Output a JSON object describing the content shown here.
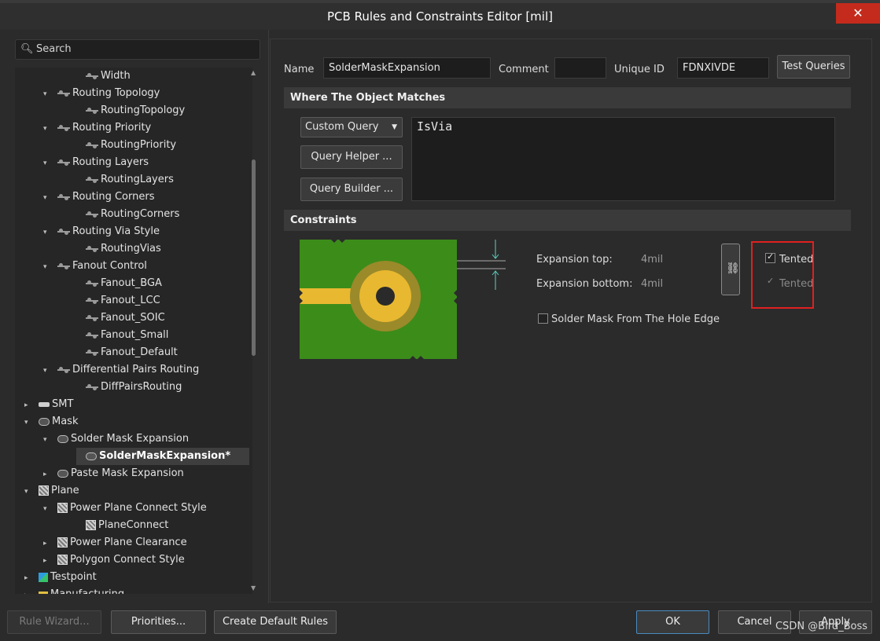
{
  "window": {
    "title": "PCB Rules and Constraints Editor [mil]",
    "close_glyph": "✕"
  },
  "search": {
    "label": "Search"
  },
  "tree": [
    {
      "label": "Width",
      "level": 3,
      "icon": "rule-icon",
      "arrow": ""
    },
    {
      "label": "Routing Topology",
      "level": 2,
      "icon": "rule-icon",
      "arrow": "▾"
    },
    {
      "label": "RoutingTopology",
      "level": 3,
      "icon": "rule-icon",
      "arrow": ""
    },
    {
      "label": "Routing Priority",
      "level": 2,
      "icon": "rule-icon",
      "arrow": "▾"
    },
    {
      "label": "RoutingPriority",
      "level": 3,
      "icon": "rule-icon",
      "arrow": ""
    },
    {
      "label": "Routing Layers",
      "level": 2,
      "icon": "rule-icon",
      "arrow": "▾"
    },
    {
      "label": "RoutingLayers",
      "level": 3,
      "icon": "rule-icon",
      "arrow": ""
    },
    {
      "label": "Routing Corners",
      "level": 2,
      "icon": "rule-icon",
      "arrow": "▾"
    },
    {
      "label": "RoutingCorners",
      "level": 3,
      "icon": "rule-icon",
      "arrow": ""
    },
    {
      "label": "Routing Via Style",
      "level": 2,
      "icon": "rule-icon",
      "arrow": "▾"
    },
    {
      "label": "RoutingVias",
      "level": 3,
      "icon": "rule-icon",
      "arrow": ""
    },
    {
      "label": "Fanout Control",
      "level": 2,
      "icon": "rule-icon",
      "arrow": "▾"
    },
    {
      "label": "Fanout_BGA",
      "level": 3,
      "icon": "rule-icon",
      "arrow": ""
    },
    {
      "label": "Fanout_LCC",
      "level": 3,
      "icon": "rule-icon",
      "arrow": ""
    },
    {
      "label": "Fanout_SOIC",
      "level": 3,
      "icon": "rule-icon",
      "arrow": ""
    },
    {
      "label": "Fanout_Small",
      "level": 3,
      "icon": "rule-icon",
      "arrow": ""
    },
    {
      "label": "Fanout_Default",
      "level": 3,
      "icon": "rule-icon",
      "arrow": ""
    },
    {
      "label": "Differential Pairs Routing",
      "level": 2,
      "icon": "rule-icon",
      "arrow": "▾"
    },
    {
      "label": "DiffPairsRouting",
      "level": 3,
      "icon": "rule-icon",
      "arrow": ""
    },
    {
      "label": "SMT",
      "level": 1,
      "icon": "smt-icon",
      "arrow": "▸"
    },
    {
      "label": "Mask",
      "level": 1,
      "icon": "mask-icon",
      "arrow": "▾"
    },
    {
      "label": "Solder Mask Expansion",
      "level": 2,
      "icon": "mask-icon",
      "arrow": "▾"
    },
    {
      "label": "SolderMaskExpansion*",
      "level": 3,
      "icon": "mask-icon",
      "arrow": "",
      "selected": true
    },
    {
      "label": "Paste Mask Expansion",
      "level": 2,
      "icon": "mask-icon",
      "arrow": "▸"
    },
    {
      "label": "Plane",
      "level": 1,
      "icon": "plane-icon",
      "arrow": "▾"
    },
    {
      "label": "Power Plane Connect Style",
      "level": 2,
      "icon": "plane-icon",
      "arrow": "▾"
    },
    {
      "label": "PlaneConnect",
      "level": 3,
      "icon": "plane-icon",
      "arrow": ""
    },
    {
      "label": "Power Plane Clearance",
      "level": 2,
      "icon": "plane-icon",
      "arrow": "▸"
    },
    {
      "label": "Polygon Connect Style",
      "level": 2,
      "icon": "plane-icon",
      "arrow": "▸"
    },
    {
      "label": "Testpoint",
      "level": 1,
      "icon": "testpoint-icon",
      "arrow": "▸"
    },
    {
      "label": "Manufacturing",
      "level": 1,
      "icon": "manufacturing-icon",
      "arrow": "▸"
    }
  ],
  "rule": {
    "name_label": "Name",
    "name_value": "SolderMaskExpansion",
    "comment_label": "Comment",
    "comment_value": "",
    "uid_label": "Unique ID",
    "uid_value": "FDNXIVDE",
    "test_queries": "Test Queries"
  },
  "where": {
    "header": "Where The Object Matches",
    "query_type": "Custom Query",
    "query_helper": "Query Helper ...",
    "query_builder": "Query Builder ...",
    "query_text": "IsVia"
  },
  "constraints": {
    "header": "Constraints",
    "expansion_top_label": "Expansion top:",
    "expansion_top_value": "4mil",
    "expansion_bottom_label": "Expansion bottom:",
    "expansion_bottom_value": "4mil",
    "tented_top_label": "Tented",
    "tented_top_checked": true,
    "tented_bottom_label": "Tented",
    "tented_bottom_checked": true,
    "hole_edge_label": "Solder Mask From The Hole Edge",
    "hole_edge_checked": false
  },
  "footer": {
    "rule_wizard": "Rule Wizard...",
    "priorities": "Priorities...",
    "create_default": "Create Default Rules",
    "ok": "OK",
    "cancel": "Cancel",
    "apply": "Apply"
  },
  "watermark": "CSDN @Bird_Boss",
  "colors": {
    "pcb_green": "#3c8c1a",
    "pad_yellow": "#e8b830",
    "mask_ring": "#9a8a2a",
    "highlight_red": "#e02020"
  }
}
